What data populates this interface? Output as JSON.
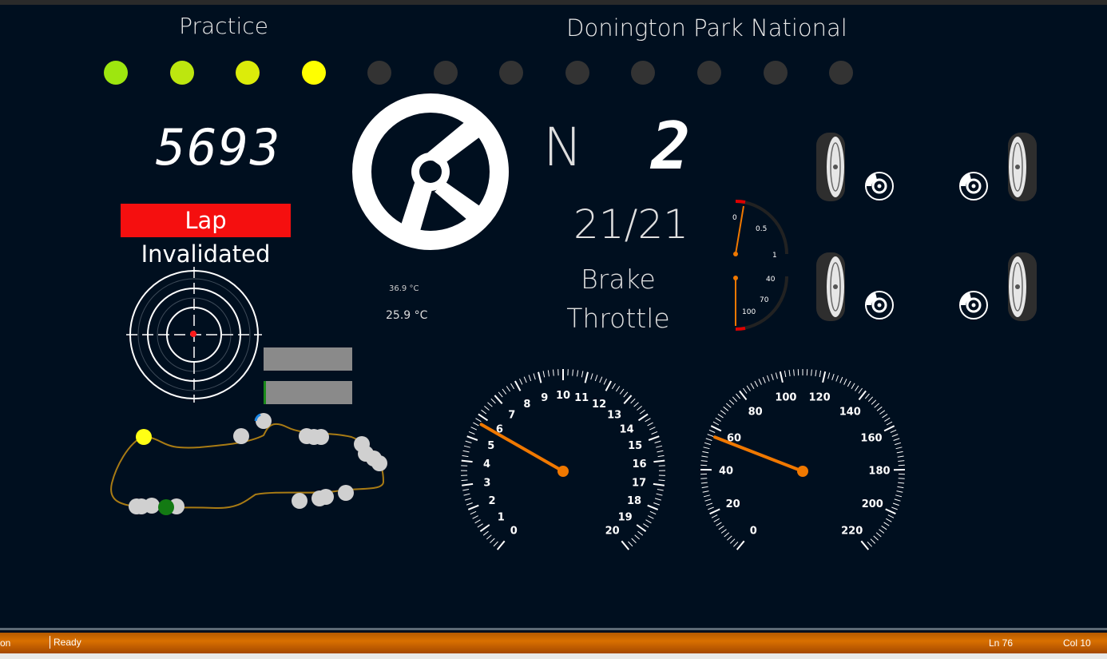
{
  "session": "Practice",
  "track": "Donington Park National",
  "rpm": "5693",
  "lap_status": "Lap Invalidated",
  "gear_mode": "N",
  "gear": "2",
  "position": "21/21",
  "brake_label": "Brake",
  "throttle_label": "Throttle",
  "temp_small": "36.9 °C",
  "temp_large": "25.9 °C",
  "shift_lights": [
    "#9ee60f",
    "#bde60f",
    "#dcec0a",
    "#ffff00",
    "#333",
    "#333",
    "#333",
    "#333",
    "#333",
    "#333",
    "#333",
    "#333"
  ],
  "mini_gauges": {
    "brake": {
      "ticks": [
        "0",
        "0.5",
        "1"
      ],
      "level": 0.05
    },
    "throttle": {
      "ticks": [
        "40",
        "70",
        "100"
      ],
      "level": 0.0
    }
  },
  "tachometer": {
    "ticks": [
      "0",
      "1",
      "2",
      "3",
      "4",
      "5",
      "6",
      "7",
      "8",
      "9",
      "10",
      "11",
      "12",
      "13",
      "14",
      "15",
      "16",
      "17",
      "18",
      "19",
      "20"
    ],
    "value": 5.7
  },
  "speedometer": {
    "ticks": [
      "0",
      "20",
      "40",
      "60",
      "80",
      "100",
      "120",
      "140",
      "160",
      "180",
      "200",
      "220"
    ],
    "value": 56
  },
  "status_bar": {
    "left_partial": "on",
    "state": "Ready",
    "line": "Ln 76",
    "col": "Col 10"
  }
}
